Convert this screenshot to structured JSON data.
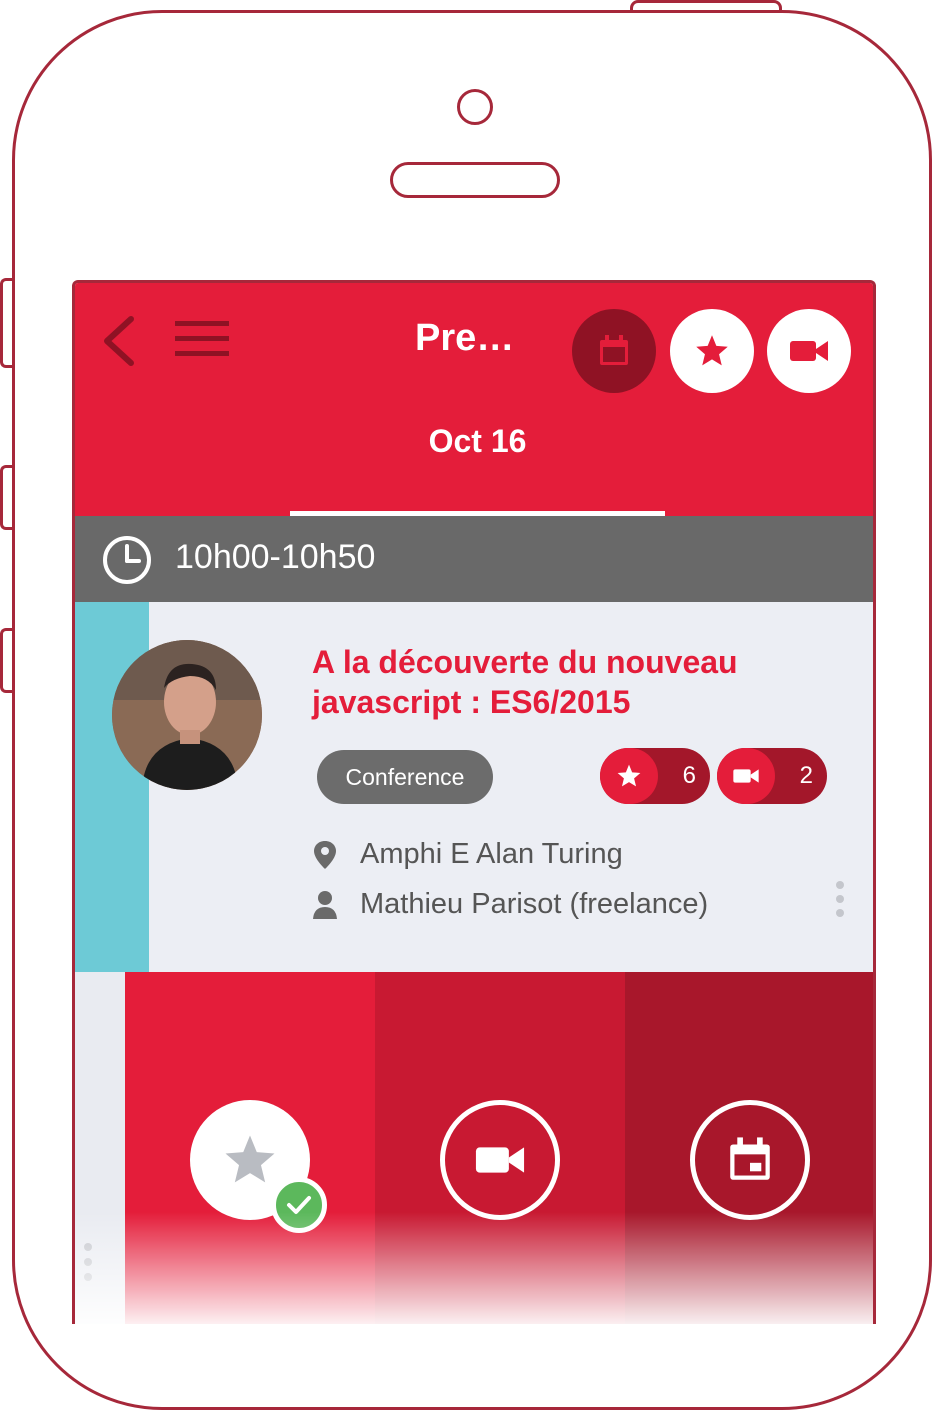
{
  "header": {
    "title": "Pre…",
    "date_tab": "Oct 16"
  },
  "slot": {
    "time": "10h00-10h50"
  },
  "talk": {
    "title": "A la découverte du nouveau javascript : ES6/2015",
    "type": "Conference",
    "favorites_count": "6",
    "videos_count": "2",
    "room": "Amphi E Alan Turing",
    "speaker": "Mathieu Parisot (freelance)"
  },
  "icons": {
    "back": "chevron-left-icon",
    "menu": "hamburger-menu-icon",
    "calendar": "calendar-icon",
    "star": "star-icon",
    "video": "video-camera-icon",
    "clock": "clock-icon",
    "location": "map-pin-icon",
    "person": "person-icon",
    "more": "more-vertical-icon",
    "check": "check-icon"
  },
  "colors": {
    "primary_red": "#e41d3a",
    "dark_red": "#a8172b",
    "mid_red": "#c81932",
    "accent_teal": "#6dcad6",
    "time_bar_gray": "#696969",
    "badge_gray": "#6c6c6c",
    "check_green": "#5cb85c"
  }
}
